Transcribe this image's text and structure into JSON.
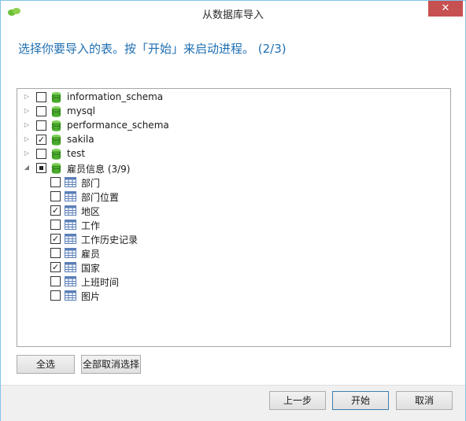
{
  "window": {
    "title": "从数据库导入",
    "close_glyph": "✕"
  },
  "instruction": "选择你要导入的表。按「开始」来启动进程。 (2/3)",
  "tree": {
    "databases": [
      {
        "label": "information_schema",
        "checked": false,
        "expanded": false
      },
      {
        "label": "mysql",
        "checked": false,
        "expanded": false
      },
      {
        "label": "performance_schema",
        "checked": false,
        "expanded": false
      },
      {
        "label": "sakila",
        "checked": true,
        "expanded": false
      },
      {
        "label": "test",
        "checked": false,
        "expanded": false
      },
      {
        "label": "雇员信息 (3/9)",
        "checked": "partial",
        "expanded": true
      }
    ],
    "tables": [
      {
        "label": "部门",
        "checked": false
      },
      {
        "label": "部门位置",
        "checked": false
      },
      {
        "label": "地区",
        "checked": true
      },
      {
        "label": "工作",
        "checked": false
      },
      {
        "label": "工作历史记录",
        "checked": true
      },
      {
        "label": "雇员",
        "checked": false
      },
      {
        "label": "国家",
        "checked": true
      },
      {
        "label": "上班时间",
        "checked": false
      },
      {
        "label": "图片",
        "checked": false
      }
    ],
    "collapsed_glyph": "▷",
    "expanded_glyph": "◢",
    "check_glyph": "✓",
    "db_icon_color": "#4caf2f",
    "table_icon_color": "#5b7fb8"
  },
  "buttons": {
    "select_all": "全选",
    "deselect_all": "全部取消选择",
    "back": "上一步",
    "start": "开始",
    "cancel": "取消"
  }
}
